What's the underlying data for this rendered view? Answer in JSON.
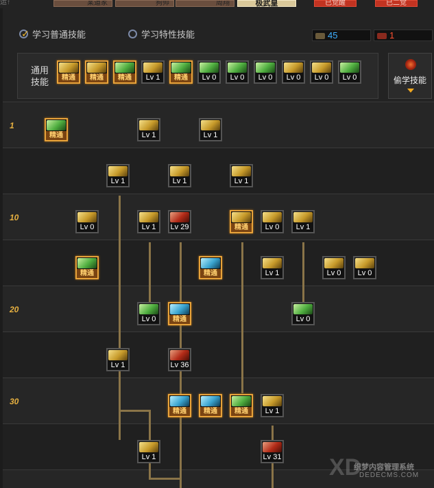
{
  "top": {
    "left_cut_text": "运↑",
    "portraits": [
      {
        "name": "某道家"
      },
      {
        "name": "狗帅"
      },
      {
        "name": "周翔"
      }
    ],
    "tag_label": "极武皇",
    "right_buttons": [
      "已觉醒",
      "已二觉"
    ]
  },
  "header": {
    "radio_common_label": "学习普通技能",
    "radio_special_label": "学习特性技能",
    "sp_value": "45",
    "tp_value": "1",
    "general_label_1": "通用",
    "general_label_2": "技能",
    "steal_label": "偷学技能"
  },
  "colors": {
    "accent": "#e6b040",
    "master_border": "#e8a33a",
    "sp_text": "#3fb0ff",
    "tp_text": "#ff5030"
  },
  "general_skills": [
    {
      "name": "general-skill-1",
      "art": "g",
      "cap": "精通",
      "master": true
    },
    {
      "name": "general-skill-2",
      "art": "g",
      "cap": "精通",
      "master": true
    },
    {
      "name": "general-skill-3",
      "art": "gr",
      "cap": "精通",
      "master": true
    },
    {
      "name": "general-skill-4",
      "art": "g",
      "cap": "Lv 1",
      "master": false
    },
    {
      "name": "general-skill-5",
      "art": "gr",
      "cap": "精通",
      "master": true
    },
    {
      "name": "general-skill-6",
      "art": "gr",
      "cap": "Lv 0",
      "master": false
    },
    {
      "name": "general-skill-7",
      "art": "gr",
      "cap": "Lv 0",
      "master": false
    },
    {
      "name": "general-skill-8",
      "art": "gr",
      "cap": "Lv 0",
      "master": false
    },
    {
      "name": "general-skill-9",
      "art": "g",
      "cap": "Lv 0",
      "master": false
    },
    {
      "name": "general-skill-10",
      "art": "g",
      "cap": "Lv 0",
      "master": false
    },
    {
      "name": "general-skill-11",
      "art": "gr",
      "cap": "Lv 0",
      "master": false
    }
  ],
  "level_markers": [
    "1",
    "10",
    "20",
    "30"
  ],
  "tree_skills": [
    {
      "art": "gr",
      "cap": "精通",
      "master": true
    },
    {
      "art": "g",
      "cap": "Lv 1",
      "master": false
    },
    {
      "art": "g",
      "cap": "Lv 1",
      "master": false
    },
    {
      "art": "g",
      "cap": "Lv 1",
      "master": false
    },
    {
      "art": "g",
      "cap": "Lv 1",
      "master": false
    },
    {
      "art": "g",
      "cap": "Lv 1",
      "master": false
    },
    {
      "art": "g",
      "cap": "Lv 0",
      "master": false
    },
    {
      "art": "g",
      "cap": "Lv 1",
      "master": false
    },
    {
      "art": "rd",
      "cap": "Lv 29",
      "master": false
    },
    {
      "art": "g",
      "cap": "精通",
      "master": true
    },
    {
      "art": "g",
      "cap": "Lv 0",
      "master": false
    },
    {
      "art": "g",
      "cap": "Lv 1",
      "master": false
    },
    {
      "art": "gr",
      "cap": "精通",
      "master": true
    },
    {
      "art": "cy",
      "cap": "精通",
      "master": true
    },
    {
      "art": "g",
      "cap": "Lv 1",
      "master": false
    },
    {
      "art": "g",
      "cap": "Lv 0",
      "master": false
    },
    {
      "art": "g",
      "cap": "Lv 0",
      "master": false
    },
    {
      "art": "gr",
      "cap": "Lv 0",
      "master": false
    },
    {
      "art": "cy",
      "cap": "精通",
      "master": true
    },
    {
      "art": "gr",
      "cap": "Lv 0",
      "master": false
    },
    {
      "art": "g",
      "cap": "Lv 1",
      "master": false
    },
    {
      "art": "rd",
      "cap": "Lv 36",
      "master": false
    },
    {
      "art": "cy",
      "cap": "精通",
      "master": true
    },
    {
      "art": "cy",
      "cap": "精通",
      "master": true
    },
    {
      "art": "gr",
      "cap": "精通",
      "master": true
    },
    {
      "art": "g",
      "cap": "Lv 1",
      "master": false
    },
    {
      "art": "g",
      "cap": "Lv 1",
      "master": false
    },
    {
      "art": "rd",
      "cap": "Lv 31",
      "master": false
    }
  ],
  "watermark": {
    "line1": "织梦内容管理系统",
    "line2": "DEDECMS.COM",
    "logo": "XD"
  }
}
